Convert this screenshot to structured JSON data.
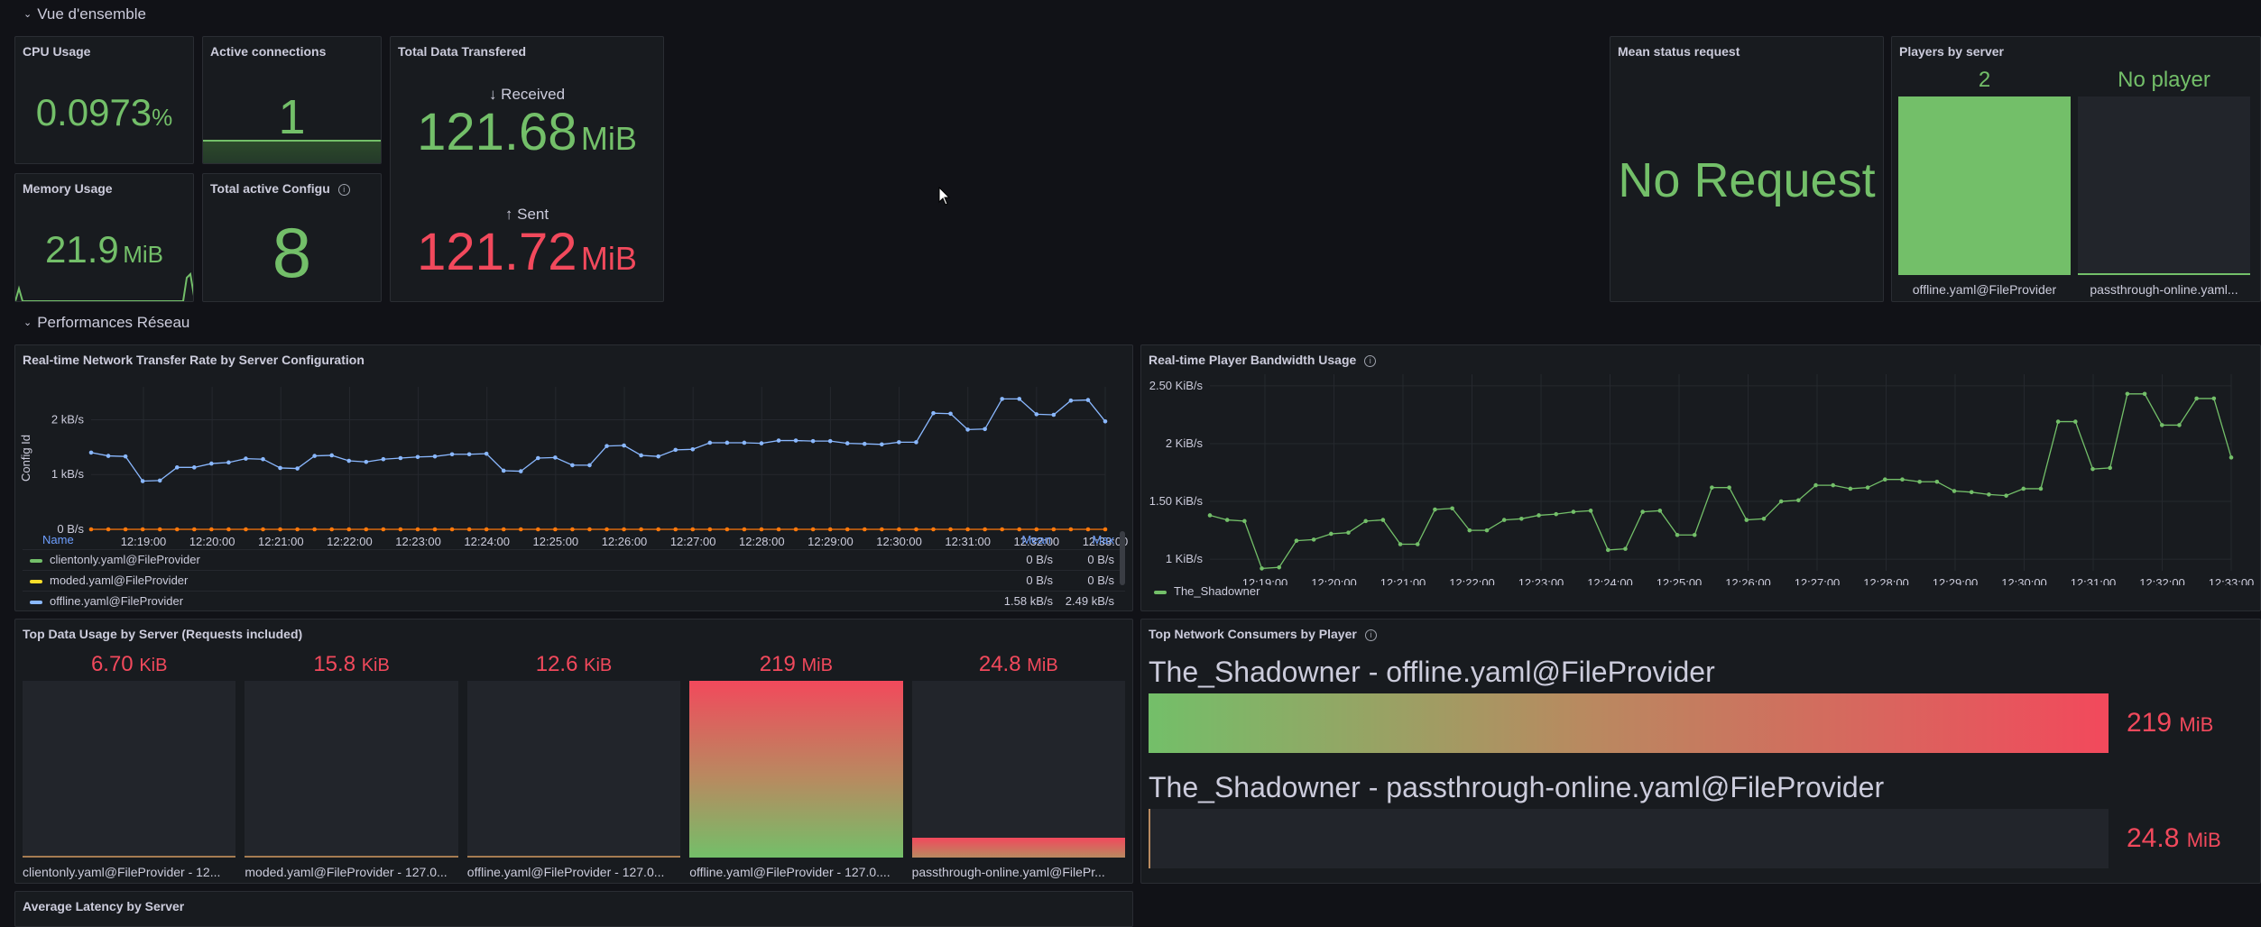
{
  "rows": {
    "overview": "Vue d'ensemble",
    "network": "Performances Réseau"
  },
  "stats": {
    "cpu": {
      "title": "CPU Usage",
      "value": "0.0973",
      "unit": "%"
    },
    "connections": {
      "title": "Active connections",
      "value": "1"
    },
    "transfer": {
      "title": "Total Data Transfered",
      "received_label": "↓ Received",
      "received_value": "121.68",
      "received_unit": "MiB",
      "sent_label": "↑ Sent",
      "sent_value": "121.72",
      "sent_unit": "MiB"
    },
    "memory": {
      "title": "Memory Usage",
      "value": "21.9",
      "unit": "MiB"
    },
    "configs": {
      "title": "Total active Configu",
      "value": "8"
    },
    "status": {
      "title": "Mean status request",
      "value": "No Request"
    },
    "players": {
      "title": "Players by server",
      "bars": [
        {
          "value_label": "2",
          "name": "offline.yaml@FileProvider",
          "fill": 1.0
        },
        {
          "value_label": "No player",
          "name": "passthrough-online.yaml...",
          "fill": 0.0
        }
      ]
    }
  },
  "network_chart": {
    "title": "Real-time Network Transfer Rate by Server Configuration",
    "ylabel": "Config Id",
    "legend_header": {
      "name": "Name",
      "mean": "Mean",
      "max": "Max"
    },
    "legend": [
      {
        "name": "clientonly.yaml@FileProvider",
        "color": "#73bf69",
        "mean": "0 B/s",
        "max": "0 B/s"
      },
      {
        "name": "moded.yaml@FileProvider",
        "color": "#fade2a",
        "mean": "0 B/s",
        "max": "0 B/s"
      },
      {
        "name": "offline.yaml@FileProvider",
        "color": "#8ab8ff",
        "mean": "1.58 kB/s",
        "max": "2.49 kB/s"
      }
    ]
  },
  "bandwidth_chart": {
    "title": "Real-time Player Bandwidth Usage",
    "legend": [
      {
        "name": "The_Shadowner",
        "color": "#73bf69"
      }
    ]
  },
  "chart_data": [
    {
      "type": "line",
      "title": "Real-time Network Transfer Rate by Server Configuration",
      "ylabel": "Config Id",
      "x_ticks": [
        "12:19:00",
        "12:20:00",
        "12:21:00",
        "12:22:00",
        "12:23:00",
        "12:24:00",
        "12:25:00",
        "12:26:00",
        "12:27:00",
        "12:28:00",
        "12:29:00",
        "12:30:00",
        "12:31:00",
        "12:32:00",
        "12:33:00"
      ],
      "y_ticks": [
        "0 B/s",
        "1 kB/s",
        "2 kB/s"
      ],
      "ylim": [
        0,
        2600
      ],
      "series": [
        {
          "name": "offline.yaml@FileProvider",
          "color": "#8ab8ff",
          "values": [
            1400,
            1340,
            1330,
            880,
            890,
            1130,
            1130,
            1200,
            1220,
            1290,
            1280,
            1120,
            1110,
            1340,
            1350,
            1250,
            1230,
            1280,
            1300,
            1320,
            1330,
            1370,
            1370,
            1380,
            1070,
            1060,
            1300,
            1310,
            1170,
            1170,
            1520,
            1530,
            1350,
            1330,
            1450,
            1460,
            1580,
            1580,
            1580,
            1570,
            1620,
            1620,
            1610,
            1610,
            1570,
            1560,
            1550,
            1590,
            1590,
            2120,
            2110,
            1820,
            1830,
            2380,
            2380,
            2100,
            2090,
            2350,
            2360,
            1970
          ]
        },
        {
          "name": "moded.yaml@FileProvider",
          "color": "#ff780a",
          "values": [
            0,
            0,
            0,
            0,
            0,
            0,
            0,
            0,
            0,
            0,
            0,
            0,
            0,
            0,
            0,
            0,
            0,
            0,
            0,
            0,
            0,
            0,
            0,
            0,
            0,
            0,
            0,
            0,
            0,
            0,
            0,
            0,
            0,
            0,
            0,
            0,
            0,
            0,
            0,
            0,
            0,
            0,
            0,
            0,
            0,
            0,
            0,
            0,
            0,
            0,
            0,
            0,
            0,
            0,
            0,
            0,
            0,
            0,
            0,
            0
          ]
        }
      ]
    },
    {
      "type": "line",
      "title": "Real-time Player Bandwidth Usage",
      "x_ticks": [
        "12:19:00",
        "12:20:00",
        "12:21:00",
        "12:22:00",
        "12:23:00",
        "12:24:00",
        "12:25:00",
        "12:26:00",
        "12:27:00",
        "12:28:00",
        "12:29:00",
        "12:30:00",
        "12:31:00",
        "12:32:00",
        "12:33:00"
      ],
      "y_ticks": [
        "1 KiB/s",
        "1.50 KiB/s",
        "2 KiB/s",
        "2.50 KiB/s"
      ],
      "ylim": [
        0.9,
        2.6
      ],
      "series": [
        {
          "name": "The_Shadowner",
          "color": "#73bf69",
          "values": [
            1.38,
            1.34,
            1.33,
            0.92,
            0.93,
            1.16,
            1.17,
            1.22,
            1.23,
            1.33,
            1.34,
            1.13,
            1.13,
            1.43,
            1.44,
            1.25,
            1.25,
            1.34,
            1.35,
            1.38,
            1.39,
            1.41,
            1.42,
            1.08,
            1.09,
            1.41,
            1.42,
            1.21,
            1.21,
            1.62,
            1.62,
            1.34,
            1.35,
            1.5,
            1.51,
            1.64,
            1.64,
            1.61,
            1.62,
            1.69,
            1.69,
            1.67,
            1.67,
            1.59,
            1.58,
            1.56,
            1.55,
            1.61,
            1.61,
            2.19,
            2.19,
            1.78,
            1.79,
            2.43,
            2.43,
            2.16,
            2.16,
            2.39,
            2.39,
            1.88
          ]
        }
      ]
    },
    {
      "type": "bar",
      "title": "Top Data Usage by Server (Requests included)",
      "categories": [
        "clientonly.yaml@FileProvider - 12...",
        "moded.yaml@FileProvider - 127.0...",
        "offline.yaml@FileProvider - 127.0...",
        "offline.yaml@FileProvider - 127.0....",
        "passthrough-online.yaml@FilePr..."
      ],
      "value_labels": [
        {
          "num": "6.70",
          "unit": "KiB"
        },
        {
          "num": "15.8",
          "unit": "KiB"
        },
        {
          "num": "12.6",
          "unit": "KiB"
        },
        {
          "num": "219",
          "unit": "MiB"
        },
        {
          "num": "24.8",
          "unit": "MiB"
        }
      ],
      "values_mib": [
        0.0065,
        0.0154,
        0.0123,
        219,
        24.8
      ],
      "max": 219
    },
    {
      "type": "bar",
      "title": "Top Network Consumers by Player",
      "categories": [
        "The_Shadowner - offline.yaml@FileProvider",
        "The_Shadowner - passthrough-online.yaml@FileProvider"
      ],
      "value_labels": [
        {
          "num": "219",
          "unit": "MiB"
        },
        {
          "num": "24.8",
          "unit": "MiB"
        }
      ],
      "values_mib": [
        219,
        24.8
      ],
      "max": 219
    }
  ],
  "latency": {
    "title": "Average Latency by Server"
  }
}
